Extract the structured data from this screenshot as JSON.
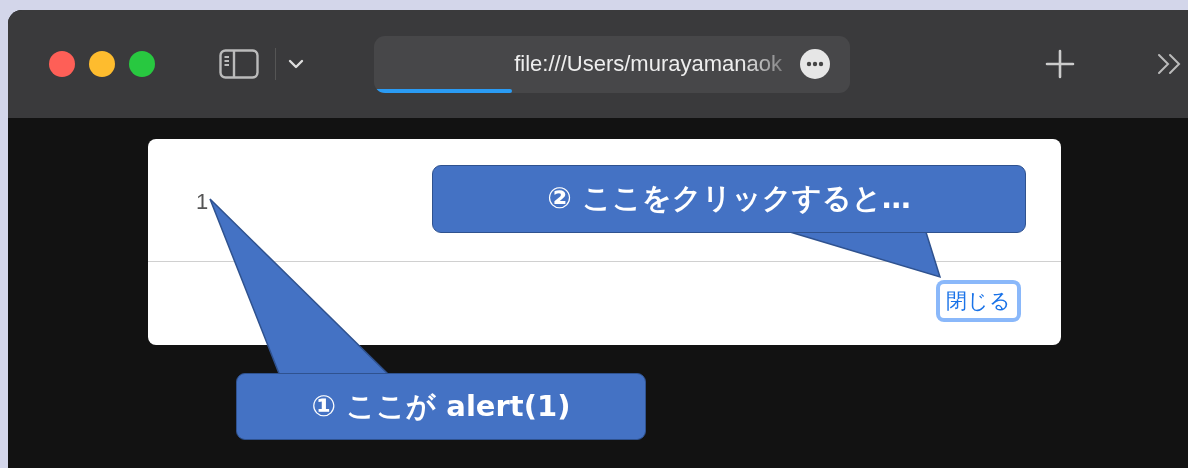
{
  "browser": {
    "address_bar": {
      "url": "file:///Users/murayamanaok",
      "loading": {
        "level": 0.29
      }
    }
  },
  "dialog": {
    "message": "1",
    "buttons": [
      {
        "label": "閉じる",
        "focused": true
      }
    ]
  },
  "callouts": [
    {
      "label": "① ここが alert(1)"
    },
    {
      "label": "② ここをクリックすると…"
    }
  ]
}
